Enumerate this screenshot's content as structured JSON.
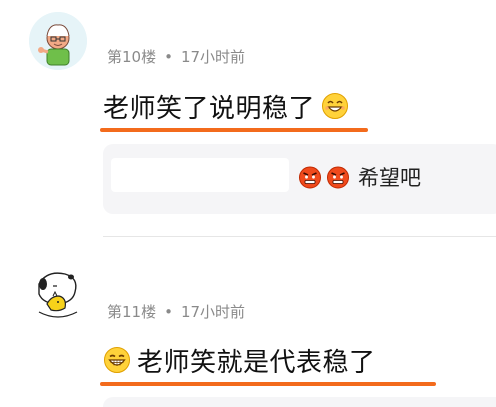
{
  "comments": [
    {
      "floor": "第10楼",
      "separator": "•",
      "time": "17小时前",
      "content": "老师笑了说明稳了",
      "content_emoji": "smile-emoji",
      "reply": {
        "emojis": [
          "angry-emoji",
          "angry-emoji"
        ],
        "text": "希望吧"
      }
    },
    {
      "floor": "第11楼",
      "separator": "•",
      "time": "17小时前",
      "content_emoji": "grin-emoji",
      "content": "老师笑就是代表稳了"
    }
  ],
  "colors": {
    "underline": "#f36b1c",
    "meta_text": "#8a8a8a",
    "reply_bg": "#f5f5f7"
  }
}
